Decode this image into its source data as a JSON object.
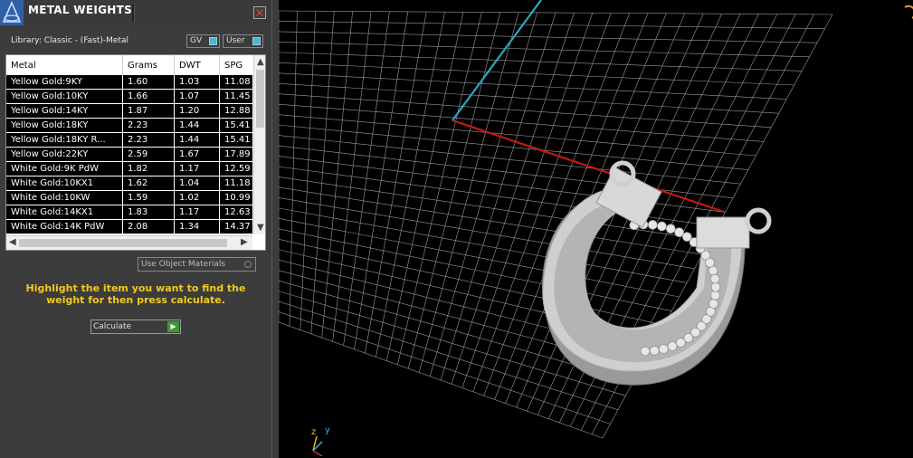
{
  "panel": {
    "title": "METAL WEIGHTS",
    "close_glyph": "✕",
    "library_label": "Library: Classic - (Fast)-Metal",
    "mode_buttons": [
      {
        "label": "GV"
      },
      {
        "label": "User"
      }
    ],
    "table": {
      "columns": [
        "Metal",
        "Grams",
        "DWT",
        "SPG"
      ],
      "rows": [
        [
          "Yellow Gold:9KY",
          "1.60",
          "1.03",
          "11.08"
        ],
        [
          "Yellow Gold:10KY",
          "1.66",
          "1.07",
          "11.45"
        ],
        [
          "Yellow Gold:14KY",
          "1.87",
          "1.20",
          "12.88"
        ],
        [
          "Yellow Gold:18KY",
          "2.23",
          "1.44",
          "15.41"
        ],
        [
          "Yellow Gold:18KY R...",
          "2.23",
          "1.44",
          "15.41"
        ],
        [
          "Yellow Gold:22KY",
          "2.59",
          "1.67",
          "17.89"
        ],
        [
          "White Gold:9K PdW",
          "1.82",
          "1.17",
          "12.59"
        ],
        [
          "White Gold:10KX1",
          "1.62",
          "1.04",
          "11.18"
        ],
        [
          "White Gold:10KW",
          "1.59",
          "1.02",
          "10.99"
        ],
        [
          "White Gold:14KX1",
          "1.83",
          "1.17",
          "12.63"
        ],
        [
          "White Gold:14K PdW",
          "2.08",
          "1.34",
          "14.37"
        ]
      ]
    },
    "use_object_materials": "Use Object Materials",
    "hint": "Highlight the item you want to find the weight for then press calculate.",
    "calculate_label": "Calculate"
  },
  "viewport": {
    "axis_labels": {
      "z": "z",
      "y": "y"
    },
    "colors": {
      "grid": "#9a9a9a",
      "x_axis": "#c01818",
      "y_axis": "#2aa8c0",
      "hint": "#f2c81e",
      "model": "#c8c8c8"
    }
  }
}
